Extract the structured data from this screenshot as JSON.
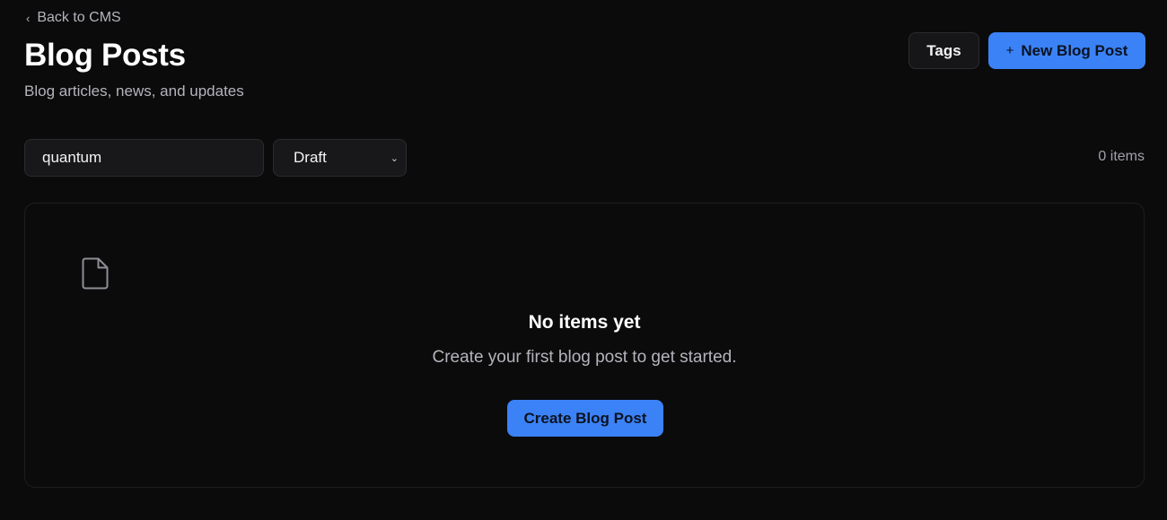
{
  "header": {
    "back_label": "Back to CMS",
    "title": "Blog Posts",
    "subtitle": "Blog articles, news, and updates",
    "tags_label": "Tags",
    "new_label": "New Blog Post"
  },
  "filters": {
    "search_value": "quantum",
    "status_selected": "Draft",
    "count_text": "0 items"
  },
  "empty_state": {
    "icon": "file-icon",
    "title": "No items yet",
    "text": "Create your first blog post to get started.",
    "cta_label": "Create Blog Post"
  },
  "colors": {
    "background": "#0b0b0c",
    "accent": "#3b82f6",
    "muted_text": "#b4b4bb"
  }
}
